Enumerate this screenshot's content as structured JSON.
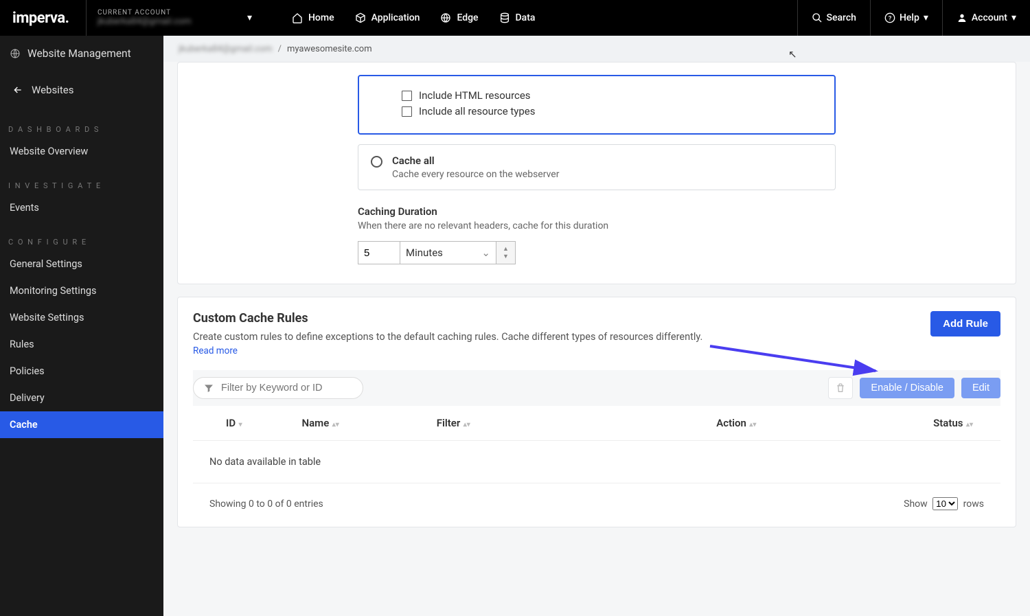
{
  "brand": "imperva",
  "topnav": {
    "account_label": "CURRENT ACCOUNT",
    "account_value": "jkuberka84@gmail.com",
    "items": {
      "home": "Home",
      "application": "Application",
      "edge": "Edge",
      "data": "Data"
    },
    "search": "Search",
    "help": "Help",
    "account": "Account"
  },
  "sidebar": {
    "header": "Website Management",
    "back": "Websites",
    "sections": {
      "dashboards": "D A S H B O A R D S",
      "investigate": "I N V E S T I G A T E",
      "configure": "C O N F I G U R E"
    },
    "items": {
      "website_overview": "Website Overview",
      "events": "Events",
      "general_settings": "General Settings",
      "monitoring_settings": "Monitoring Settings",
      "website_settings": "Website Settings",
      "rules": "Rules",
      "policies": "Policies",
      "delivery": "Delivery",
      "cache": "Cache"
    }
  },
  "breadcrumb": {
    "account": "jkuberka84@gmail.com",
    "site": "myawesomesite.com"
  },
  "caching": {
    "include_html": "Include HTML resources",
    "include_all": "Include all resource types",
    "cache_all_title": "Cache all",
    "cache_all_desc": "Cache every resource on the webserver",
    "duration_title": "Caching Duration",
    "duration_desc": "When there are no relevant headers, cache for this duration",
    "duration_value": "5",
    "duration_unit": "Minutes"
  },
  "rules": {
    "title": "Custom Cache Rules",
    "desc": "Create custom rules to define exceptions to the default caching rules. Cache different types of resources differently.",
    "read_more": "Read more",
    "add_rule": "Add Rule",
    "filter_placeholder": "Filter by Keyword or ID",
    "enable_disable": "Enable / Disable",
    "edit": "Edit",
    "cols": {
      "id": "ID",
      "name": "Name",
      "filter": "Filter",
      "action": "Action",
      "status": "Status"
    },
    "no_data": "No data available in table",
    "showing": "Showing 0 to 0 of 0 entries",
    "show_label": "Show",
    "rows_label": "rows",
    "page_size": "10"
  }
}
